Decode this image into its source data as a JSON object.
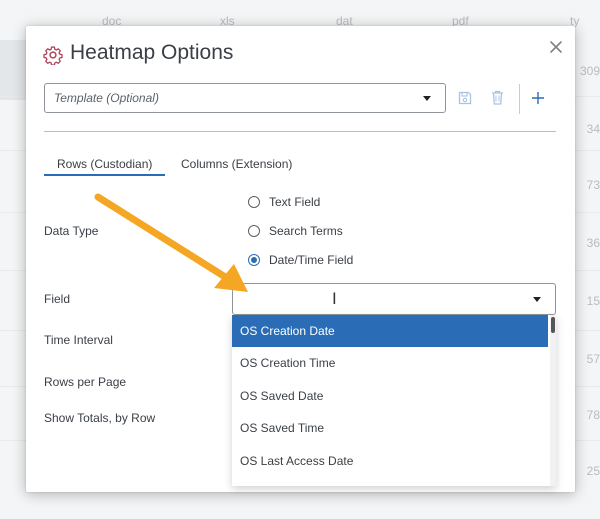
{
  "background": {
    "column_headers": [
      "doc",
      "xls",
      "dat",
      "pdf",
      "ty"
    ],
    "row_values": [
      "309",
      "34",
      "73",
      "36",
      "15",
      "57",
      "78",
      "25"
    ]
  },
  "dialog": {
    "title": "Heatmap Options",
    "template_placeholder": "Template (Optional)",
    "tabs": [
      {
        "label": "Rows (Custodian)",
        "active": true
      },
      {
        "label": "Columns (Extension)",
        "active": false
      }
    ],
    "labels": {
      "data_type": "Data Type",
      "field": "Field",
      "time_interval": "Time Interval",
      "rows_per_page": "Rows per Page",
      "show_totals": "Show Totals, by Row"
    },
    "data_type_options": [
      {
        "label": "Text Field",
        "checked": false
      },
      {
        "label": "Search Terms",
        "checked": false
      },
      {
        "label": "Date/Time Field",
        "checked": true
      }
    ],
    "field_value": "",
    "field_dropdown_options": [
      {
        "label": "OS Creation Date",
        "selected": true
      },
      {
        "label": "OS Creation Time",
        "selected": false
      },
      {
        "label": "OS Saved Date",
        "selected": false
      },
      {
        "label": "OS Saved Time",
        "selected": false
      },
      {
        "label": "OS Last Access Date",
        "selected": false
      }
    ]
  },
  "colors": {
    "accent": "#2a6db6",
    "annotation_arrow": "#f5a623",
    "title_icon": "#b0455f"
  }
}
